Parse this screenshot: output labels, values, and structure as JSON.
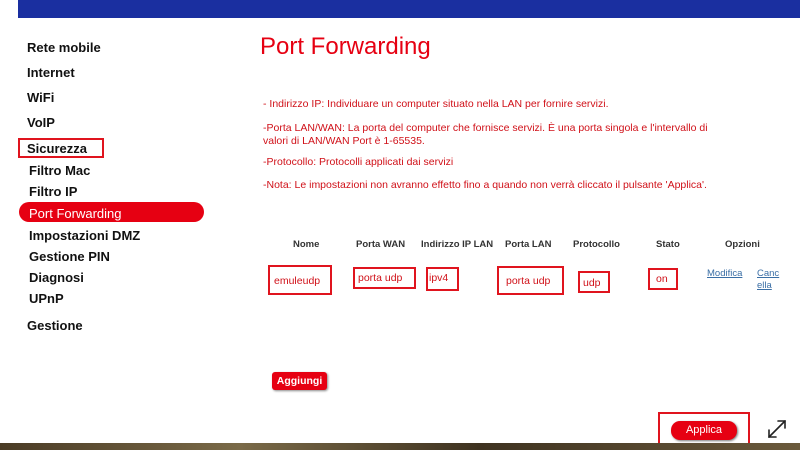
{
  "colors": {
    "accent": "#e60012",
    "topbar": "#1a2fa0",
    "link": "#3a6ea5"
  },
  "sidebar": {
    "items": [
      {
        "label": "Rete mobile"
      },
      {
        "label": "Internet"
      },
      {
        "label": "WiFi"
      },
      {
        "label": "VoIP"
      },
      {
        "label": "Sicurezza"
      },
      {
        "label": "Filtro Mac"
      },
      {
        "label": "Filtro IP"
      },
      {
        "label": "Port Forwarding"
      },
      {
        "label": "Impostazioni DMZ"
      },
      {
        "label": "Gestione PIN"
      },
      {
        "label": "Diagnosi"
      },
      {
        "label": "UPnP"
      },
      {
        "label": "Gestione"
      }
    ]
  },
  "main": {
    "title": "Port Forwarding",
    "help": [
      "- Indirizzo IP: Individuare un computer situato nella LAN per fornire servizi.",
      "-Porta LAN/WAN: La porta del computer che fornisce servizi. È una porta singola e l'intervallo di valori di LAN/WAN Port è 1-65535.",
      "-Protocollo: Protocolli applicati dai servizi",
      "-Nota: Le impostazioni non avranno effetto fino a quando non verrà cliccato il pulsante 'Applica'."
    ],
    "table": {
      "headers": [
        "Nome",
        "Porta WAN",
        "Indirizzo IP LAN",
        "Porta LAN",
        "Protocollo",
        "Stato",
        "Opzioni"
      ],
      "rows": [
        {
          "nome": "emuleudp",
          "porta_wan": "porta udp",
          "ip_lan": "ipv4",
          "porta_lan": "porta udp",
          "protocollo": "udp",
          "stato": "on",
          "modifica": "Modifica",
          "cancella_line1": "Canc",
          "cancella_line2": "ella"
        }
      ]
    },
    "add_button": "Aggiungi",
    "apply_button": "Applica"
  },
  "icons": {
    "expand": "expand-icon"
  }
}
